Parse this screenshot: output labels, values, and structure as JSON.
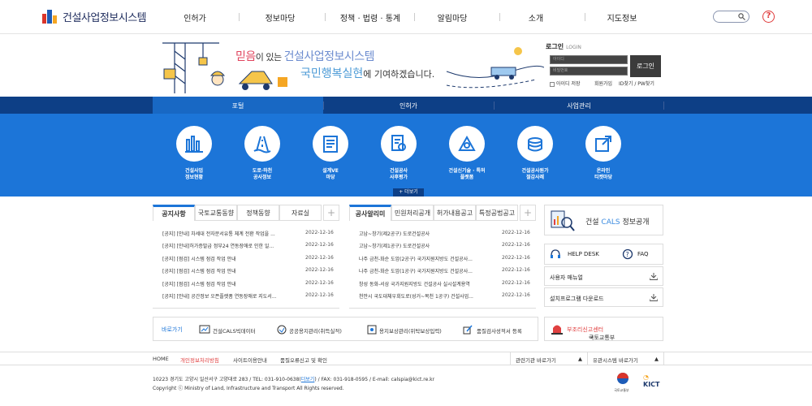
{
  "header": {
    "logo_text": "건설사업정보시스템",
    "menu": [
      "인허가",
      "정보마당",
      "정책 · 법령 · 통계",
      "알림마당",
      "소개",
      "지도정보"
    ],
    "help_icon": "question-circle-icon"
  },
  "banner": {
    "line1_red": "믿음",
    "line1_mid": "이 있는 ",
    "line1_blue": "건설사업정보시스템",
    "line2_blue": "국민행복실현",
    "line2_rest": "에 기여하겠습니다."
  },
  "login": {
    "title": "로그인",
    "title_en": "LOGIN",
    "id_placeholder": "아이디",
    "pw_placeholder": "비밀번호",
    "button": "로그인",
    "save_id": "아이디 저장",
    "join": "회원가입",
    "find": "ID찾기 / PW찾기"
  },
  "tabs": [
    "포털",
    "인허가",
    "사업관리"
  ],
  "quick": [
    {
      "l1": "건설사업",
      "l2": "정보현황"
    },
    {
      "l1": "도로·하천",
      "l2": "공사정보"
    },
    {
      "l1": "설계VE",
      "l2": "마당"
    },
    {
      "l1": "건설공사",
      "l2": "사후평가"
    },
    {
      "l1": "건설신기술 · 특허",
      "l2": "플랫폼"
    },
    {
      "l1": "건설공사원가",
      "l2": "절감사례"
    },
    {
      "l1": "온라인",
      "l2": "티켓마당"
    }
  ],
  "more_label": "+ 더보기",
  "notice": {
    "tabs": [
      "공지사항",
      "국토교통동향",
      "정책동향",
      "자료실"
    ],
    "rows": [
      {
        "t": "[공지] [안내] 차세대 전자문서유통 체계 전환 작업을 ...",
        "d": "2022-12-16"
      },
      {
        "t": "[공지] [안내]허가증발급 정부24 연동장애로 인한 일...",
        "d": "2022-12-16"
      },
      {
        "t": "[공지] [점검] 시스템 점검 작업 안내",
        "d": "2022-12-16"
      },
      {
        "t": "[공지] [점검] 시스템 점검 작업 안내",
        "d": "2022-12-16"
      },
      {
        "t": "[공지] [점검] 시스템 점검 작업 안내",
        "d": "2022-12-16"
      },
      {
        "t": "[공지] [안내] 공간정보 오픈플랫폼 연동장애로 지도서...",
        "d": "2022-12-16"
      }
    ]
  },
  "public": {
    "tabs": [
      "공사알리미",
      "민원처리공개",
      "허가내용공고",
      "특정공법공고"
    ],
    "rows": [
      {
        "t": "고남~창기(제2공구) 도로건설공사",
        "d": "2022-12-16"
      },
      {
        "t": "고남~창기(제1공구) 도로건설공사",
        "d": "2022-12-16"
      },
      {
        "t": "나주 금천-화순 도암(2공구) 국가지원지방도 건설공사...",
        "d": "2022-12-16"
      },
      {
        "t": "나주 금천-화순 도암(1공구) 국가지원지방도 건설공사...",
        "d": "2022-12-16"
      },
      {
        "t": "창성 동화-서삼 국가지원지방도 건설공사 실시설계용역",
        "d": "2022-12-16"
      },
      {
        "t": "천안시 국도대체우회도로(성거~목천 1공구) 건설사업...",
        "d": "2022-12-16"
      }
    ]
  },
  "right": {
    "cals_pre": "건설 ",
    "cals_blue": "CALS",
    "cals_post": " 정보공개",
    "helpdesk": "HELP DESK",
    "faq": "FAQ",
    "manual": "사용자 매뉴얼",
    "download": "설치프로그램 다운로드"
  },
  "shortcut": {
    "label": "바로가기",
    "items": [
      "건설CALS빅데이터",
      "공공용지관리(취득실적)",
      "용지보상관리(위탁보상입력)",
      "품질검사성적서 등록"
    ]
  },
  "report": {
    "pre": "국토교통부 ",
    "red": "부조리신고센터",
    "arrow": "→"
  },
  "footer": {
    "home": "HOME",
    "privacy": "개인정보처리방침",
    "terms": "사이트이용안내",
    "error": "품질오류신고 및 확인",
    "related": "관련기관 바로가기",
    "systems": "유관시스템 바로가기",
    "address": "10223 경기도 고양시 일산서구 고양대로 283 / TEL: 031-910-0638(",
    "more": "더보기",
    "address2": ") / FAX: 031-918-0595 / E-mail: calspia@kict.re.kr",
    "copyright": "Copyright ⓒ Ministry of Land, Infrastructure and Transport All Rights reserved.",
    "mark1": "국토교통부",
    "mark2": "KICT"
  }
}
